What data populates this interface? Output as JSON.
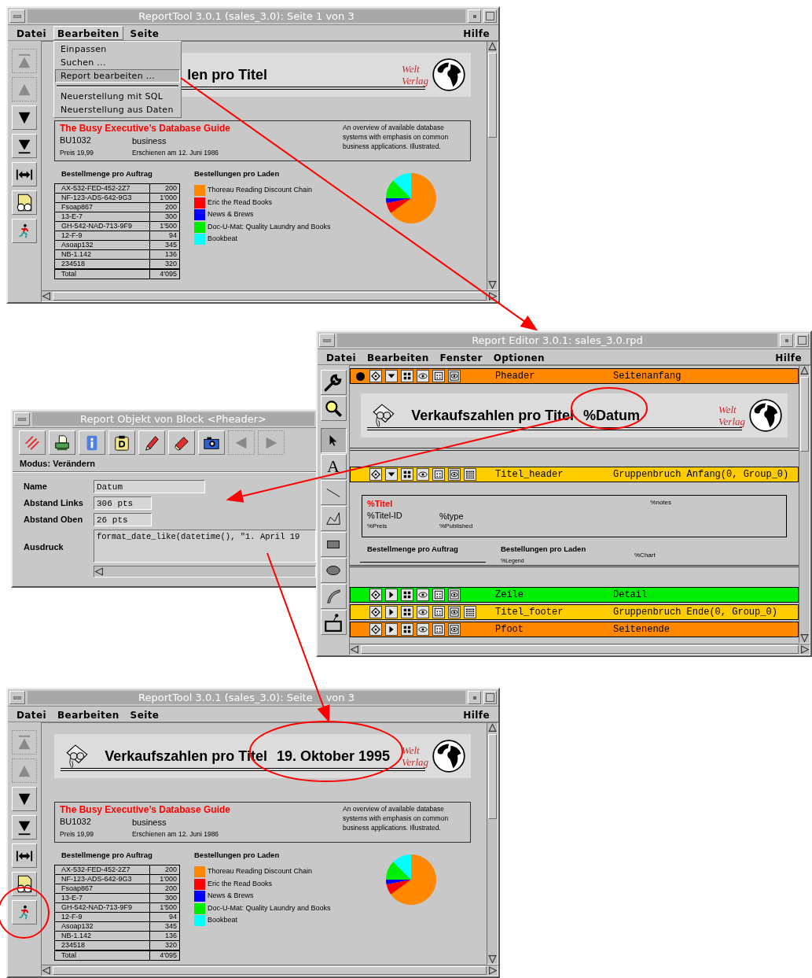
{
  "report_tool_top": {
    "title": "ReportTool 3.0.1 (sales_3.0): Seite 1 von 3",
    "menu": [
      {
        "label": "Datei",
        "selected": false
      },
      {
        "label": "Bearbeiten",
        "selected": true
      },
      {
        "label": "Seite",
        "selected": false
      },
      {
        "label": "Hilfe",
        "selected": false
      }
    ],
    "dropdown": [
      {
        "kind": "item",
        "label": "Einpassen",
        "selected": false
      },
      {
        "kind": "item",
        "label": "Suchen ...",
        "selected": false
      },
      {
        "kind": "item",
        "label": "Report bearbeiten ...",
        "selected": true
      },
      {
        "kind": "separator"
      },
      {
        "kind": "item",
        "label": "Neuerstellung mit SQL",
        "selected": false
      },
      {
        "kind": "item",
        "label": "Neuerstellung aus Daten",
        "selected": false
      }
    ],
    "nav_buttons": [
      {
        "disabled": true
      },
      {
        "disabled": true
      },
      {
        "disabled": false
      },
      {
        "disabled": false
      },
      {
        "disabled": false
      },
      {
        "disabled": false
      },
      {
        "disabled": false
      }
    ],
    "report": {
      "header": {
        "title": "len pro Titel",
        "publisher": [
          "Welt",
          "Verlag"
        ]
      },
      "book": {
        "title": "The Busy Executive’s Database Guide",
        "id": "BU1032",
        "type": "business",
        "price": "Preis 19,99",
        "published": "Erschienen am 12. Juni 1986",
        "notes": "An overview of available database systems with emphasis on common business applications. Illustrated."
      },
      "orders_heading": "Bestellmenge pro Auftrag",
      "orders": [
        {
          "id": "AX-532-FED-452-2Z7",
          "quantity": "200"
        },
        {
          "id": "NF-123-ADS-642-9G3",
          "quantity": "1'000"
        },
        {
          "id": "Fsoap867",
          "quantity": "200"
        },
        {
          "id": "13-E-7",
          "quantity": "300"
        },
        {
          "id": "GH-542-NAD-713-9F9",
          "quantity": "1'500"
        },
        {
          "id": "12-F-9",
          "quantity": "94"
        },
        {
          "id": "Asoap132",
          "quantity": "345"
        },
        {
          "id": "NB-1.142",
          "quantity": "136"
        },
        {
          "id": "234518",
          "quantity": "320"
        }
      ],
      "total": {
        "label": "Total",
        "quantity": "4'095"
      },
      "stores_heading": "Bestellungen pro Laden",
      "stores": [
        {
          "name": "Thoreau Reading Discount Chain",
          "color": "#ff8800"
        },
        {
          "name": "Eric the Read Books",
          "color": "#ff0000"
        },
        {
          "name": "News & Brews",
          "color": "#0000ff"
        },
        {
          "name": "Doc-U-Mat: Quality Laundry and Books",
          "color": "#00ee00"
        },
        {
          "name": "Bookbeat",
          "color": "#00ffff"
        }
      ]
    }
  },
  "report_editor": {
    "title": "Report Editor 3.0.1: sales_3.0.rpd",
    "menu": [
      {
        "label": "Datei",
        "selected": false
      },
      {
        "label": "Bearbeiten",
        "selected": false
      },
      {
        "label": "Fenster",
        "selected": false
      },
      {
        "label": "Optionen",
        "selected": false
      },
      {
        "label": "Hilfe",
        "selected": false
      }
    ],
    "tools": [
      {
        "selected": false
      },
      {
        "selected": false
      },
      {
        "selected": true
      },
      {
        "label": "A",
        "selected": false
      },
      {
        "selected": false
      },
      {
        "selected": false
      },
      {
        "selected": false
      },
      {
        "selected": false
      },
      {
        "selected": false
      },
      {
        "selected": false
      }
    ],
    "bands": [
      {
        "name": "Pheader",
        "type": "Seitenanfang",
        "color": "#ff8800",
        "kind": "page",
        "current": true,
        "expanded": true,
        "header": {
          "logo": true,
          "title": "Verkaufszahlen pro Titel",
          "date": "%Datum",
          "publisher": [
            "Welt",
            "Verlag"
          ]
        }
      },
      {
        "name": "Titel_header",
        "type": "Gruppenbruch Anfang(0, Group_0)",
        "color": "#ffcc00",
        "kind": "group",
        "current": false,
        "expanded": true,
        "layout": {
          "title": "%Titel",
          "notes": "%notes",
          "id": "%Titel-ID",
          "type": "%type",
          "price": "%Preis",
          "published": "%Published",
          "orders_heading": "Bestellmenge pro Auftrag",
          "stores_heading": "Bestellungen pro Laden",
          "chart": "%Chart",
          "legend": "%Legend"
        }
      },
      {
        "name": "Zeile",
        "type": "Detail",
        "color": "#00ee00",
        "kind": "detail",
        "current": false,
        "expanded": false
      },
      {
        "name": "Titel_footer",
        "type": "Gruppenbruch Ende(0, Group_0)",
        "color": "#ffcc00",
        "kind": "group",
        "current": false,
        "expanded": false
      },
      {
        "name": "Pfoot",
        "type": "Seitenende",
        "color": "#ff8800",
        "kind": "page",
        "current": false,
        "expanded": false
      }
    ]
  },
  "object_window": {
    "title": "Report Objekt von Block <Pheader>",
    "tools": [
      {
        "disabled": false
      },
      {
        "disabled": false
      },
      {
        "disabled": false
      },
      {
        "disabled": false
      },
      {
        "disabled": false
      },
      {
        "disabled": false
      },
      {
        "disabled": false
      },
      {
        "disabled": true
      },
      {
        "disabled": true
      }
    ],
    "mode": "Modus: Verändern",
    "fields": [
      {
        "label": "Name",
        "value": "Datum",
        "kind": "text"
      },
      {
        "label": "Abstand Links",
        "value": "306 pts",
        "kind": "short"
      },
      {
        "label": "Abstand Oben",
        "value": "26 pts",
        "kind": "short"
      },
      {
        "label": "Ausdruck",
        "value": "format_date_like(datetime(), \"1. April 19",
        "kind": "multiline"
      }
    ]
  },
  "report_tool_bottom": {
    "title": [
      "ReportTool 3.0.1 (sales_3.0): Seite",
      "von 3"
    ],
    "menu": [
      {
        "label": "Datei",
        "selected": false
      },
      {
        "label": "Bearbeiten",
        "selected": false
      },
      {
        "label": "Seite",
        "selected": false
      },
      {
        "label": "Hilfe",
        "selected": false
      }
    ],
    "nav_buttons": [
      {
        "disabled": true
      },
      {
        "disabled": true
      },
      {
        "disabled": false
      },
      {
        "disabled": false
      },
      {
        "disabled": false
      },
      {
        "disabled": false
      },
      {
        "disabled": false
      }
    ],
    "report": {
      "header": {
        "logo": true,
        "title": "Verkaufszahlen pro Titel",
        "date": "19. Oktober 1995",
        "publisher": [
          "Welt",
          "Verlag"
        ]
      },
      "book": {
        "title": "The Busy Executive’s Database Guide",
        "id": "BU1032",
        "type": "business",
        "price": "Preis 19,99",
        "published": "Erschienen am 12. Juni 1986",
        "notes": "An overview of available database systems with emphasis on common business applications. Illustrated."
      },
      "orders_heading": "Bestellmenge pro Auftrag",
      "orders": [
        {
          "id": "AX-532-FED-452-2Z7",
          "quantity": "200"
        },
        {
          "id": "NF-123-ADS-642-9G3",
          "quantity": "1'000"
        },
        {
          "id": "Fsoap867",
          "quantity": "200"
        },
        {
          "id": "13-E-7",
          "quantity": "300"
        },
        {
          "id": "GH-542-NAD-713-9F9",
          "quantity": "1'500"
        },
        {
          "id": "12-F-9",
          "quantity": "94"
        },
        {
          "id": "Asoap132",
          "quantity": "345"
        },
        {
          "id": "NB-1.142",
          "quantity": "136"
        },
        {
          "id": "234518",
          "quantity": "320"
        }
      ],
      "total": {
        "label": "Total",
        "quantity": "4'095"
      },
      "stores_heading": "Bestellungen pro Laden",
      "stores": [
        {
          "name": "Thoreau Reading Discount Chain",
          "color": "#ff8800"
        },
        {
          "name": "Eric the Read Books",
          "color": "#ff0000"
        },
        {
          "name": "News & Brews",
          "color": "#0000ff"
        },
        {
          "name": "Doc-U-Mat: Quality Laundry and Books",
          "color": "#00ee00"
        },
        {
          "name": "Bookbeat",
          "color": "#00ffff"
        }
      ]
    }
  }
}
